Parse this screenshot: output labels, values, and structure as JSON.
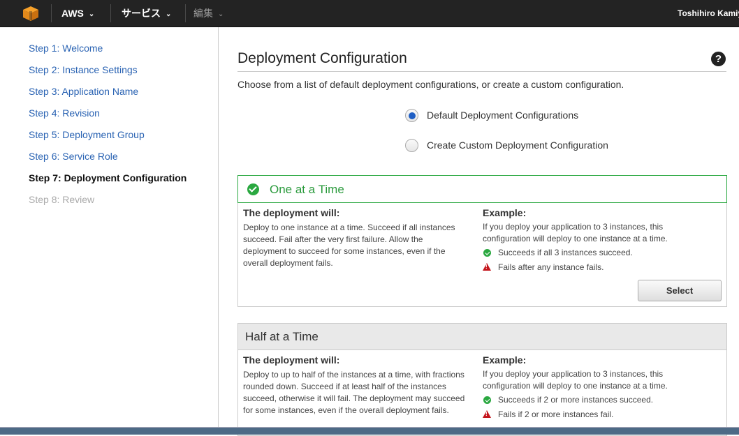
{
  "topbar": {
    "logo": "aws-cube-icon",
    "brand_label": "AWS",
    "services_label": "サービス",
    "edit_label": "編集",
    "user_name": "Toshihiro Kamiya"
  },
  "sidebar": {
    "steps": [
      {
        "label": "Step 1: Welcome",
        "state": "link"
      },
      {
        "label": "Step 2: Instance Settings",
        "state": "link"
      },
      {
        "label": "Step 3: Application Name",
        "state": "link"
      },
      {
        "label": "Step 4: Revision",
        "state": "link"
      },
      {
        "label": "Step 5: Deployment Group",
        "state": "link"
      },
      {
        "label": "Step 6: Service Role",
        "state": "link"
      },
      {
        "label": "Step 7: Deployment Configuration",
        "state": "active"
      },
      {
        "label": "Step 8: Review",
        "state": "disabled"
      }
    ]
  },
  "main": {
    "title": "Deployment Configuration",
    "help_label": "?",
    "description": "Choose from a list of default deployment configurations, or create a custom configuration.",
    "options": [
      {
        "label": "Default Deployment Configurations",
        "selected": true
      },
      {
        "label": "Create Custom Deployment Configuration",
        "selected": false
      }
    ],
    "configs": [
      {
        "title": "One at a Time",
        "selected": true,
        "deployment_heading": "The deployment will:",
        "deployment_text": "Deploy to one instance at a time. Succeed if all instances succeed. Fail after the very first failure. Allow the deployment to succeed for some instances, even if the overall deployment fails.",
        "example_heading": "Example:",
        "example_text": "If you deploy your application to 3 instances, this configuration will deploy to one instance at a time.",
        "success_text": "Succeeds if all 3 instances succeed.",
        "failure_text": "Fails after any instance fails.",
        "button_label": "Select"
      },
      {
        "title": "Half at a Time",
        "selected": false,
        "deployment_heading": "The deployment will:",
        "deployment_text": "Deploy to up to half of the instances at a time, with fractions rounded down. Succeed if at least half of the instances succeed, otherwise it will fail. The deployment may succeed for some instances, even if the overall deployment fails.",
        "example_heading": "Example:",
        "example_text": "If you deploy your application to 3 instances, this configuration will deploy to one instance at a time.",
        "success_text": "Succeeds if 2 or more instances succeed.",
        "failure_text": "Fails if 2 or more instances fail."
      }
    ]
  },
  "colors": {
    "link": "#2a63b3",
    "success": "#2aa840",
    "error": "#c4161c",
    "topbar": "#232323"
  }
}
